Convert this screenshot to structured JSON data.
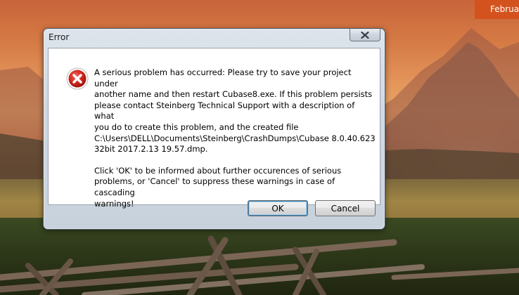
{
  "desktop": {
    "date_flyout_text": "Februa"
  },
  "dialog": {
    "title": "Error",
    "close_icon": "close-icon",
    "error_icon": "error-icon",
    "message_paragraph_1": "A serious problem has occurred: Please try to save your project under\nanother name and then restart Cubase8.exe. If this problem persists\nplease contact Steinberg Technical Support with a description of what\nyou do to create this problem, and the created file\nC:\\Users\\DELL\\Documents\\Steinberg\\CrashDumps\\Cubase 8.0.40.623\n32bit 2017.2.13 19.57.dmp.",
    "message_paragraph_2": "Click 'OK' to be informed about further occurences of serious\nproblems, or 'Cancel' to suppress these warnings in case of cascading\nwarnings!",
    "ok_label": "OK",
    "cancel_label": "Cancel"
  },
  "colors": {
    "error_red": "#c8211a",
    "flyout_orange": "#d4521e"
  }
}
